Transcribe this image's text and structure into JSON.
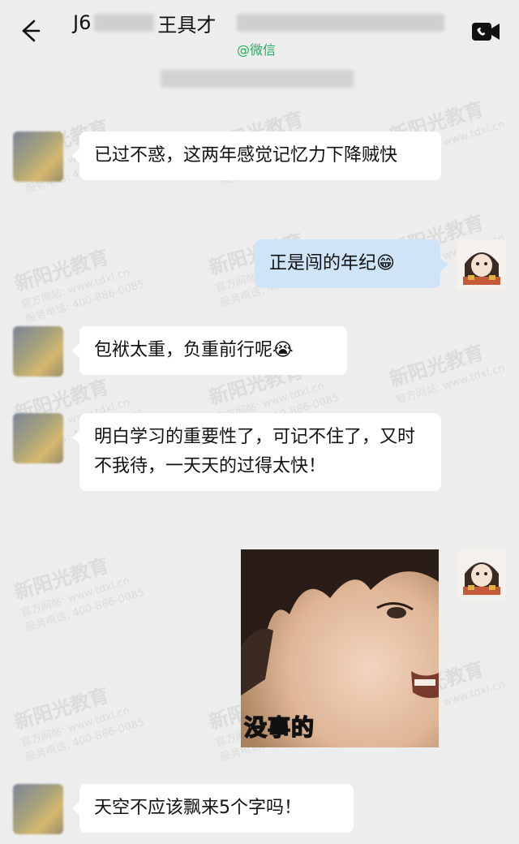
{
  "header": {
    "title_prefix": "J6",
    "title_name": "王具才",
    "source_tag": "@微信",
    "back_icon": "back-arrow-icon",
    "video_icon": "video-call-icon"
  },
  "watermark": {
    "brand": "新阳光教育",
    "line1": "官方网站: www.tdxl.cn",
    "line2": "服务电话: 400-886-0085"
  },
  "messages": [
    {
      "side": "in",
      "text": "已过不惑，这两年感觉记忆力下降贼快"
    },
    {
      "side": "out",
      "text": "正是闯的年纪",
      "emoji": "😁"
    },
    {
      "side": "in",
      "text": "包袱太重，负重前行呢",
      "emoji": "😭"
    },
    {
      "side": "in",
      "text": "明白学习的重要性了，可记不住了，又时不我待，一天天的过得太快！"
    },
    {
      "side": "out",
      "type": "sticker",
      "caption": "没事的"
    },
    {
      "side": "in",
      "text": "天空不应该飘来5个字吗！"
    }
  ],
  "colors": {
    "background": "#ededed",
    "incoming_bubble": "#ffffff",
    "outgoing_bubble": "#cfe4f7",
    "wechat_green": "#20b25a"
  }
}
